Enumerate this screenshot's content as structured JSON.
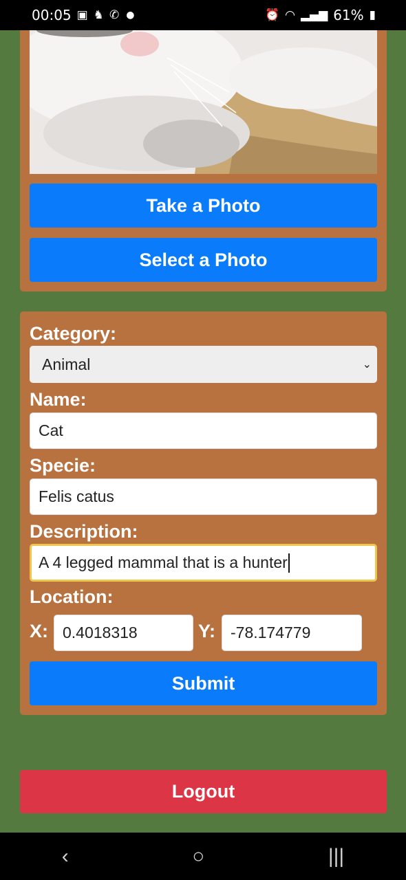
{
  "status_bar": {
    "time": "00:05",
    "battery": "61%",
    "left_icons": [
      "image-icon",
      "accessibility-icon",
      "whatsapp-icon"
    ],
    "right_icons": [
      "alarm-icon",
      "wifi-icon",
      "signal-icon",
      "battery-icon"
    ]
  },
  "photo_section": {
    "take_photo_label": "Take a Photo",
    "select_photo_label": "Select a Photo"
  },
  "form": {
    "category_label": "Category:",
    "category_value": "Animal",
    "name_label": "Name:",
    "name_value": "Cat",
    "specie_label": "Specie:",
    "specie_value": "Felis catus",
    "description_label": "Description:",
    "description_value": "A 4 legged mammal that is a hunter",
    "location_label": "Location:",
    "x_label": "X:",
    "x_value": "0.4018318",
    "y_label": "Y:",
    "y_value": "-78.174779",
    "submit_label": "Submit"
  },
  "logout_label": "Logout",
  "nav_bar": {
    "back": "‹",
    "home": "○",
    "recents": "|||"
  },
  "colors": {
    "background": "#557a40",
    "panel": "#b87240",
    "primary": "#0a7cfb",
    "danger": "#dc3545"
  }
}
